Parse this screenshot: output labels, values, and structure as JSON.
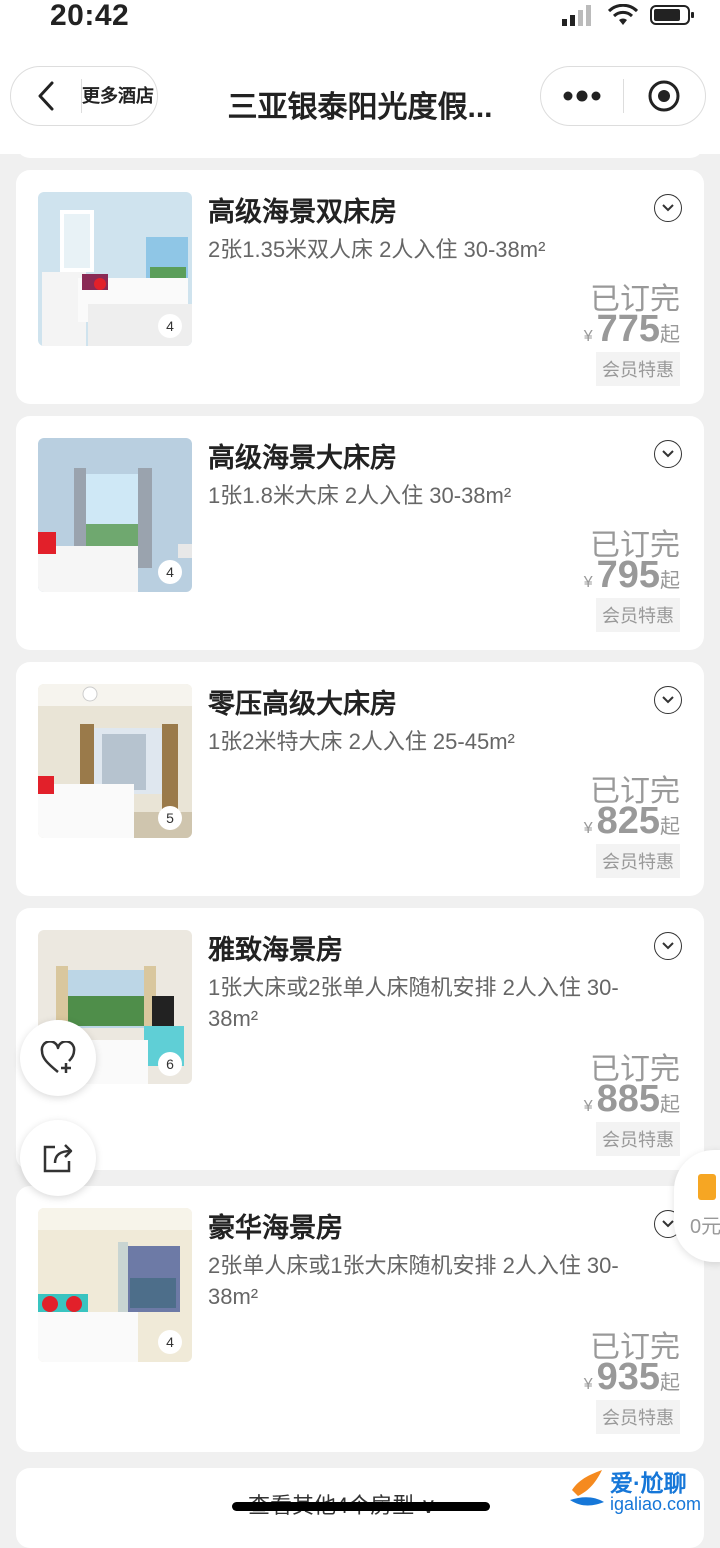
{
  "status_bar": {
    "time": "20:42"
  },
  "nav": {
    "more_hotels": "更多酒店",
    "title": "三亚银泰阳光度假..."
  },
  "rooms": [
    {
      "name": "高级海景双床房",
      "desc": "2张1.35米双人床  2人入住  30-38m²",
      "photo_count": "4",
      "status": "已订完",
      "currency": "¥",
      "price": "775",
      "price_suffix": "起",
      "tag": "会员特惠"
    },
    {
      "name": "高级海景大床房",
      "desc": "1张1.8米大床  2人入住  30-38m²",
      "photo_count": "4",
      "status": "已订完",
      "currency": "¥",
      "price": "795",
      "price_suffix": "起",
      "tag": "会员特惠"
    },
    {
      "name": "零压高级大床房",
      "desc": "1张2米特大床  2人入住  25-45m²",
      "photo_count": "5",
      "status": "已订完",
      "currency": "¥",
      "price": "825",
      "price_suffix": "起",
      "tag": "会员特惠"
    },
    {
      "name": "雅致海景房",
      "desc": "1张大床或2张单人床随机安排  2人入住  30-38m²",
      "photo_count": "6",
      "status": "已订完",
      "currency": "¥",
      "price": "885",
      "price_suffix": "起",
      "tag": "会员特惠"
    },
    {
      "name": "豪华海景房",
      "desc": "2张单人床或1张大床随机安排  2人入住  30-38m²",
      "photo_count": "4",
      "status": "已订完",
      "currency": "¥",
      "price": "935",
      "price_suffix": "起",
      "tag": "会员特惠"
    }
  ],
  "more_rooms": "查看其他4个房型 ∨",
  "side_widget": {
    "label": "0元"
  },
  "watermark": {
    "text": "爱·尬聊",
    "url": "igaliao.com"
  },
  "icons": {
    "back": "chevron-left-icon",
    "more": "more-dots-icon",
    "close_mini": "target-icon",
    "favorite": "heart-plus-icon",
    "share": "share-icon",
    "expand": "chevron-down-circle-icon"
  }
}
